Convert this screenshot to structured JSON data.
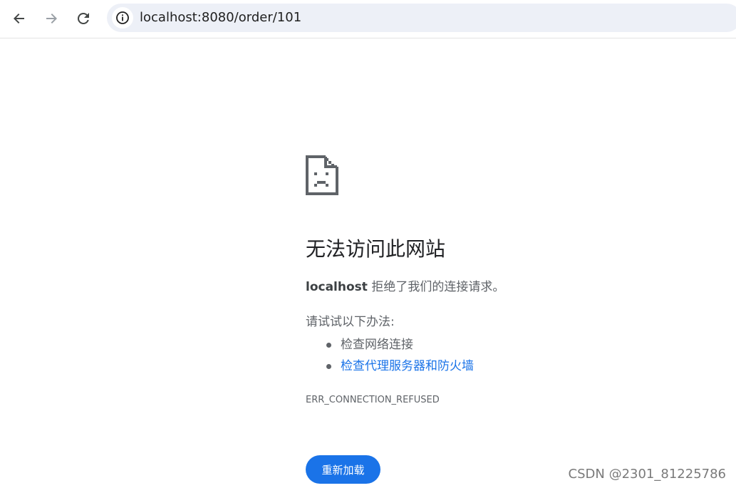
{
  "browser": {
    "url": "localhost:8080/order/101",
    "icons": {
      "back": "arrow-left-icon",
      "forward": "arrow-right-icon",
      "reload": "reload-icon",
      "site_info": "info-icon"
    }
  },
  "error_page": {
    "icon": "sad-document-icon",
    "headline": "无法访问此网站",
    "host": "localhost",
    "description": " 拒绝了我们的连接请求。",
    "try_title": "请试试以下办法:",
    "suggestions": [
      {
        "label": "检查网络连接",
        "is_link": false
      },
      {
        "label": "检查代理服务器和防火墙",
        "is_link": true
      }
    ],
    "error_code": "ERR_CONNECTION_REFUSED",
    "reload_button_label": "重新加载"
  },
  "watermark": "CSDN @2301_81225786",
  "colors": {
    "link": "#1a73e8",
    "button_bg": "#1a73e8",
    "omnibox_bg": "#edf0f7",
    "text_secondary": "#5f6368"
  }
}
